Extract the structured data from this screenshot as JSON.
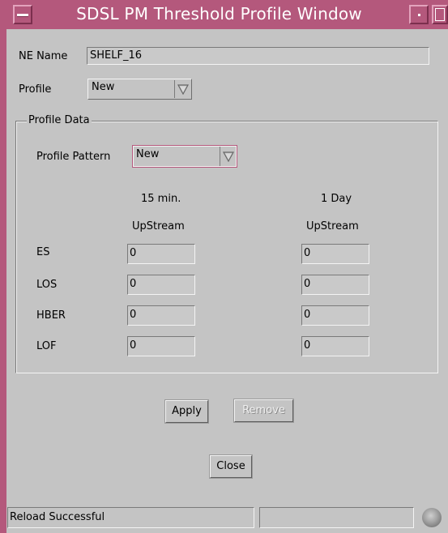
{
  "window": {
    "title": "SDSL PM Threshold Profile Window"
  },
  "ne": {
    "label": "NE Name",
    "value": "SHELF_16"
  },
  "profile": {
    "label": "Profile",
    "value": "New"
  },
  "profile_data": {
    "title": "Profile Data",
    "pattern_label": "Profile Pattern",
    "pattern_value": "New",
    "col1_header": "15 min.",
    "col1_sub": "UpStream",
    "col2_header": "1 Day",
    "col2_sub": "UpStream",
    "rows": [
      {
        "label": "ES",
        "v15": "0",
        "v1d": "0"
      },
      {
        "label": "LOS",
        "v15": "0",
        "v1d": "0"
      },
      {
        "label": "HBER",
        "v15": "0",
        "v1d": "0"
      },
      {
        "label": "LOF",
        "v15": "0",
        "v1d": "0"
      }
    ]
  },
  "buttons": {
    "apply": "Apply",
    "remove": "Remove",
    "close": "Close"
  },
  "status": {
    "message": "Reload Successful",
    "secondary": ""
  },
  "colors": {
    "titlebar": "#b4587c",
    "background": "#c4c4c4"
  },
  "icons": {
    "menu": "window-menu-icon",
    "minimize": "minimize-icon",
    "maximize": "maximize-icon",
    "dropdown": "dropdown-arrow-icon",
    "status": "status-light-icon"
  }
}
